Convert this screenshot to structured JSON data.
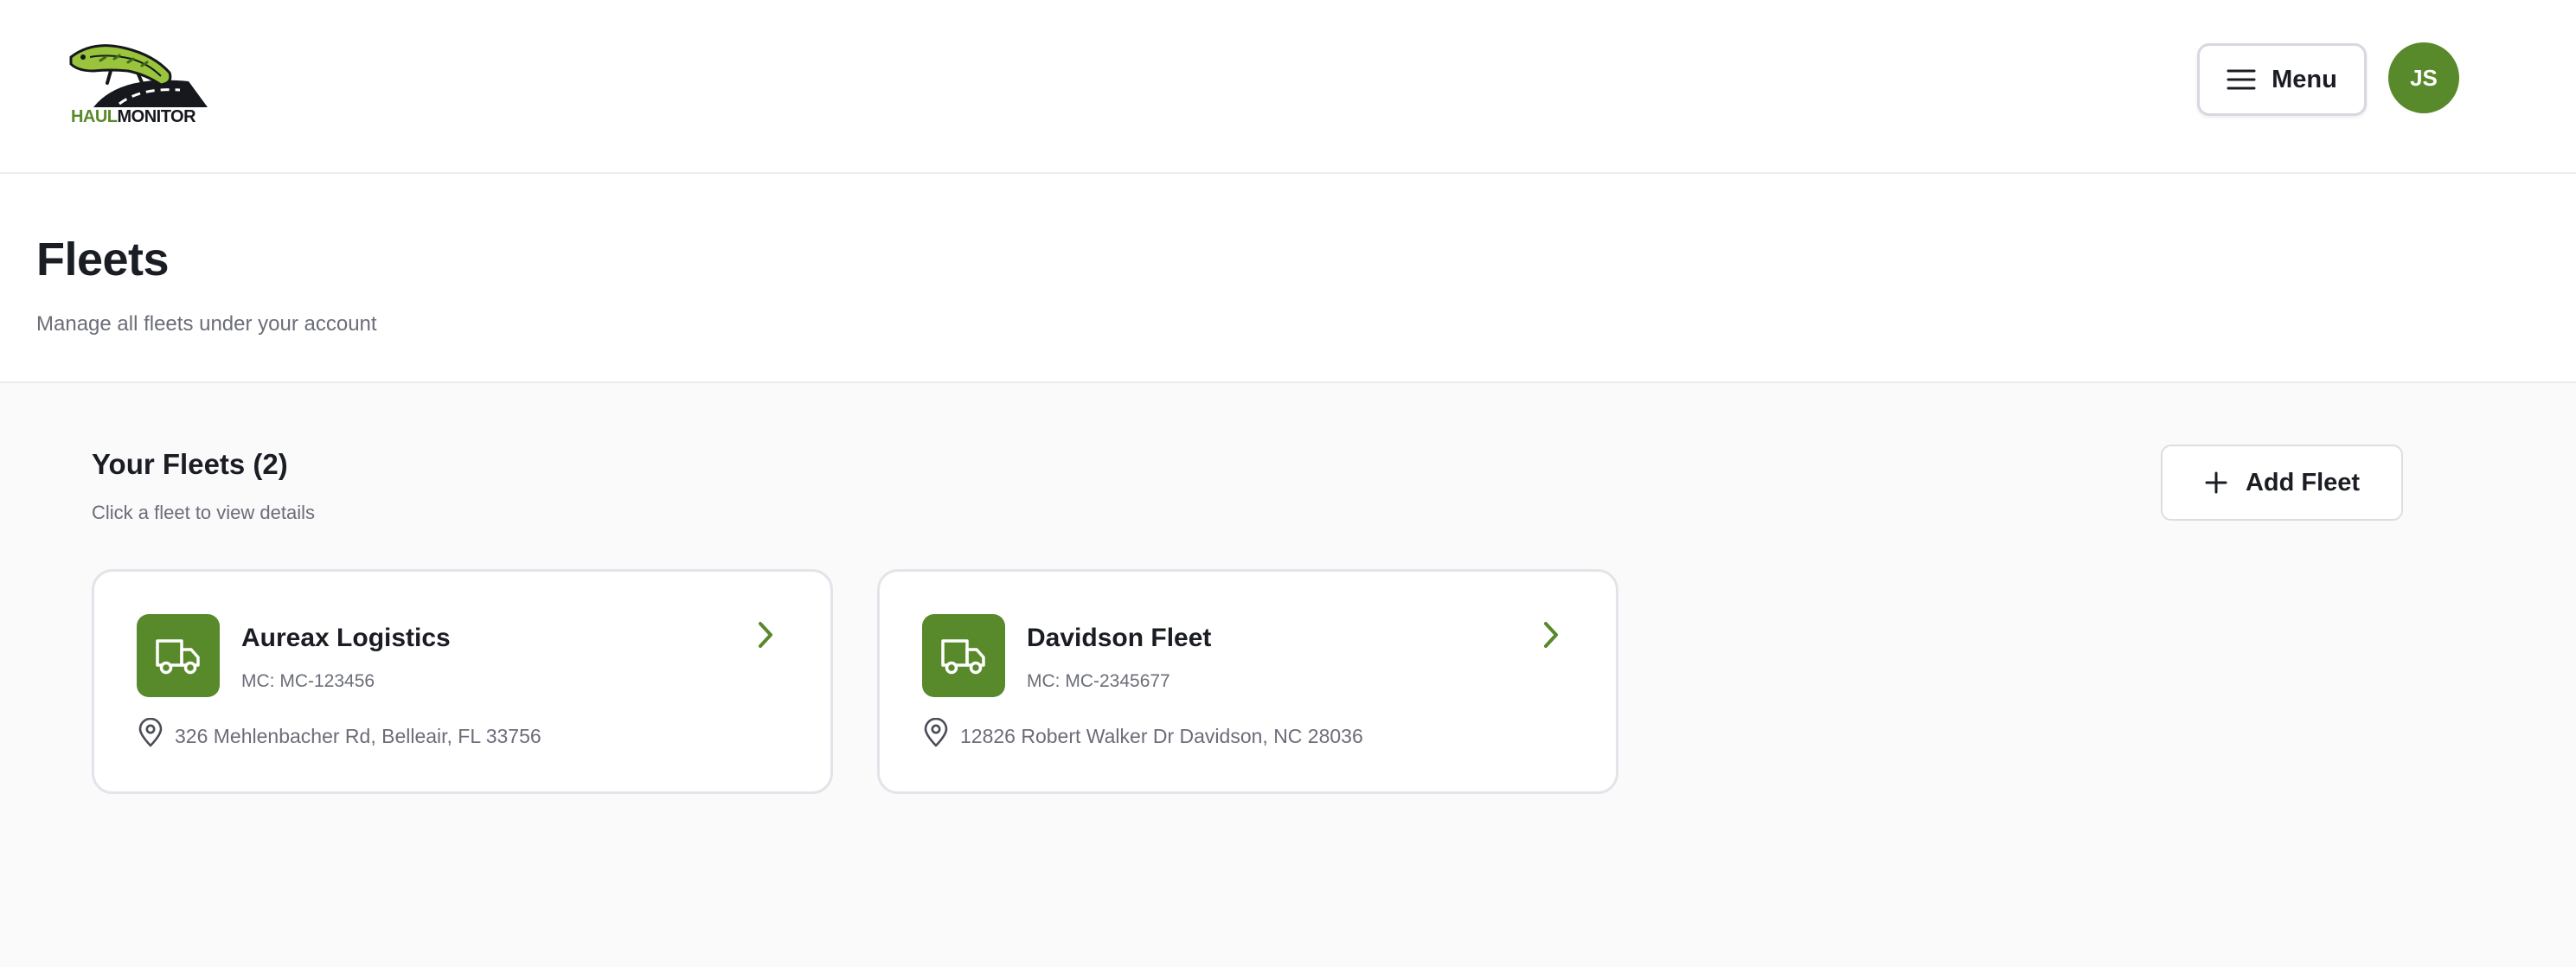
{
  "header": {
    "logo": {
      "text_part1": "HAUL",
      "text_part2": "MONITOR",
      "icon": "gecko-road-logo"
    },
    "menu_button": {
      "label": "Menu",
      "icon": "hamburger-icon"
    },
    "avatar": {
      "initials": "JS"
    }
  },
  "page": {
    "title": "Fleets",
    "subtitle": "Manage all fleets under your account"
  },
  "fleets_section": {
    "title": "Your Fleets (2)",
    "subtitle": "Click a fleet to view details",
    "add_button": {
      "label": "Add Fleet",
      "icon": "plus-icon"
    },
    "fleets": [
      {
        "name": "Aureax Logistics",
        "mc": "MC: MC-123456",
        "address": "326 Mehlenbacher Rd, Belleair, FL 33756"
      },
      {
        "name": "Davidson Fleet",
        "mc": "MC: MC-2345677",
        "address": "12826 Robert Walker Dr Davidson, NC 28036"
      }
    ]
  },
  "colors": {
    "brand_green": "#58892b",
    "text_primary": "#1b1d24",
    "text_secondary": "#6b6d78",
    "border": "#e3e4ea",
    "content_background": "#fafafa"
  }
}
